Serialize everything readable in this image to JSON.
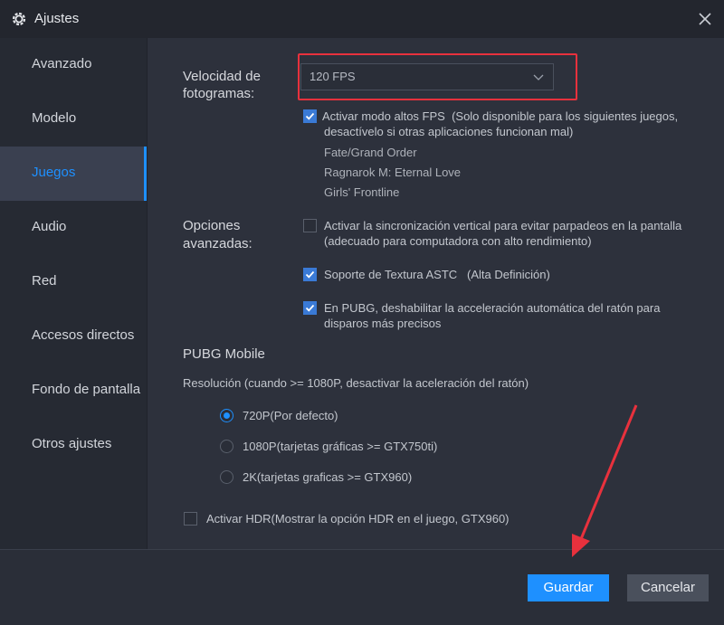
{
  "window": {
    "title": "Ajustes"
  },
  "sidebar": {
    "items": [
      {
        "label": "Avanzado"
      },
      {
        "label": "Modelo"
      },
      {
        "label": "Juegos"
      },
      {
        "label": "Audio"
      },
      {
        "label": "Red"
      },
      {
        "label": "Accesos directos"
      },
      {
        "label": "Fondo de pantalla"
      },
      {
        "label": "Otros ajustes"
      }
    ],
    "active": "Juegos"
  },
  "fps": {
    "label_line1": "Velocidad de",
    "label_line2": "fotogramas:",
    "selected": "120 FPS",
    "high_fps": {
      "checked": true,
      "label": "Activar modo altos FPS",
      "note_line1": "(Solo disponible para los siguientes juegos,",
      "note_line2": "desactívelo si otras aplicaciones funcionan mal)",
      "games": [
        "Fate/Grand Order",
        "Ragnarok M: Eternal Love",
        "Girls' Frontline"
      ]
    }
  },
  "advanced": {
    "label_line1": "Opciones",
    "label_line2": "avanzadas:",
    "vsync": {
      "checked": false,
      "line1": "Activar la sincronización vertical para evitar parpadeos en la pantalla",
      "line2": "(adecuado para computadora con alto rendimiento)"
    },
    "astc": {
      "checked": true,
      "label": "Soporte de Textura ASTC",
      "note": "(Alta Definición)"
    },
    "pubg_mouse": {
      "checked": true,
      "line1": "En PUBG, deshabilitar la acceleración automática del ratón para",
      "line2": "disparos más precisos"
    }
  },
  "pubg": {
    "heading": "PUBG Mobile",
    "resolution_label": "Resolución (cuando >= 1080P, desactivar la aceleración del ratón)",
    "options": [
      {
        "label": "720P(Por defecto)",
        "selected": true
      },
      {
        "label": "1080P(tarjetas gráficas >= GTX750ti)",
        "selected": false
      },
      {
        "label": "2K(tarjetas graficas >= GTX960)",
        "selected": false
      }
    ],
    "hdr": {
      "checked": false,
      "label": "Activar HDR(Mostrar la opción HDR en el juego, GTX960)"
    }
  },
  "footer": {
    "save_label": "Guardar",
    "cancel_label": "Cancelar"
  },
  "colors": {
    "accent": "#1e90ff",
    "highlight": "#e8313d",
    "background": "#2d313c"
  }
}
